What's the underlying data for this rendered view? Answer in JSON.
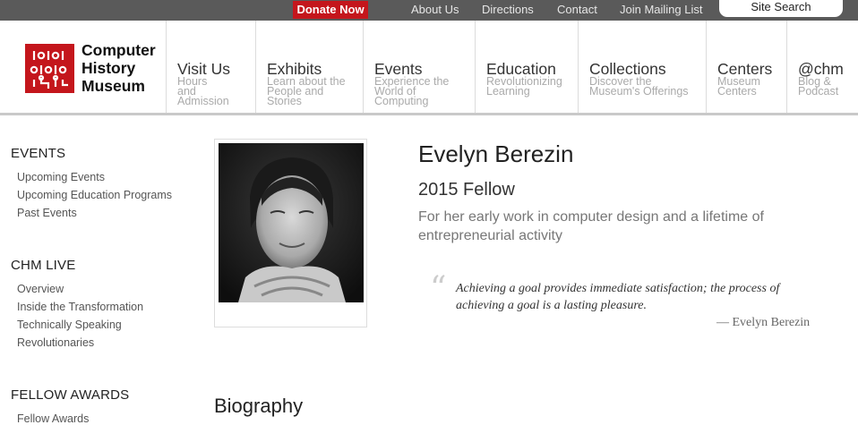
{
  "topbar": {
    "donate": "Donate Now",
    "links": [
      "About Us",
      "Directions",
      "Contact",
      "Join Mailing List"
    ],
    "search_placeholder": "Site Search"
  },
  "logo": {
    "lines": [
      "Computer",
      "History",
      "Museum"
    ],
    "icon": "chm-circuit-logo-icon"
  },
  "nav": [
    {
      "title": "Visit Us",
      "sub": [
        "Hours",
        "and",
        "Admission"
      ]
    },
    {
      "title": "Exhibits",
      "sub": [
        "Learn about the",
        "People and",
        "Stories"
      ]
    },
    {
      "title": "Events",
      "sub": [
        "Experience the",
        "World of",
        "Computing"
      ]
    },
    {
      "title": "Education",
      "sub": [
        "Revolutionizing",
        "Learning"
      ]
    },
    {
      "title": "Collections",
      "sub": [
        "Discover the",
        "Museum's Offerings"
      ]
    },
    {
      "title": "Centers",
      "sub": [
        "Museum",
        "Centers"
      ]
    },
    {
      "title": "@chm",
      "sub": [
        "Blog &",
        "Podcast"
      ]
    }
  ],
  "sidebar": {
    "sections": [
      {
        "heading": "EVENTS",
        "links": [
          "Upcoming Events",
          "Upcoming Education Programs",
          "Past Events"
        ]
      },
      {
        "heading": "CHM LIVE",
        "links": [
          "Overview",
          "Inside the Transformation",
          "Technically Speaking",
          "Revolutionaries"
        ]
      },
      {
        "heading": "FELLOW AWARDS",
        "links": [
          "Fellow Awards"
        ]
      }
    ]
  },
  "profile": {
    "name": "Evelyn Berezin",
    "fellow_year": "2015 Fellow",
    "citation": "For her early work in computer design and a lifetime of entrepreneurial activity",
    "quote": "Achieving a goal provides immediate satisfaction; the process of achieving a goal is a lasting pleasure.",
    "quote_attribution": "— Evelyn Berezin",
    "section_heading": "Biography"
  },
  "colors": {
    "topbar": "#5a5a5a",
    "donate": "#c4161c",
    "brand_red": "#c4161c"
  }
}
